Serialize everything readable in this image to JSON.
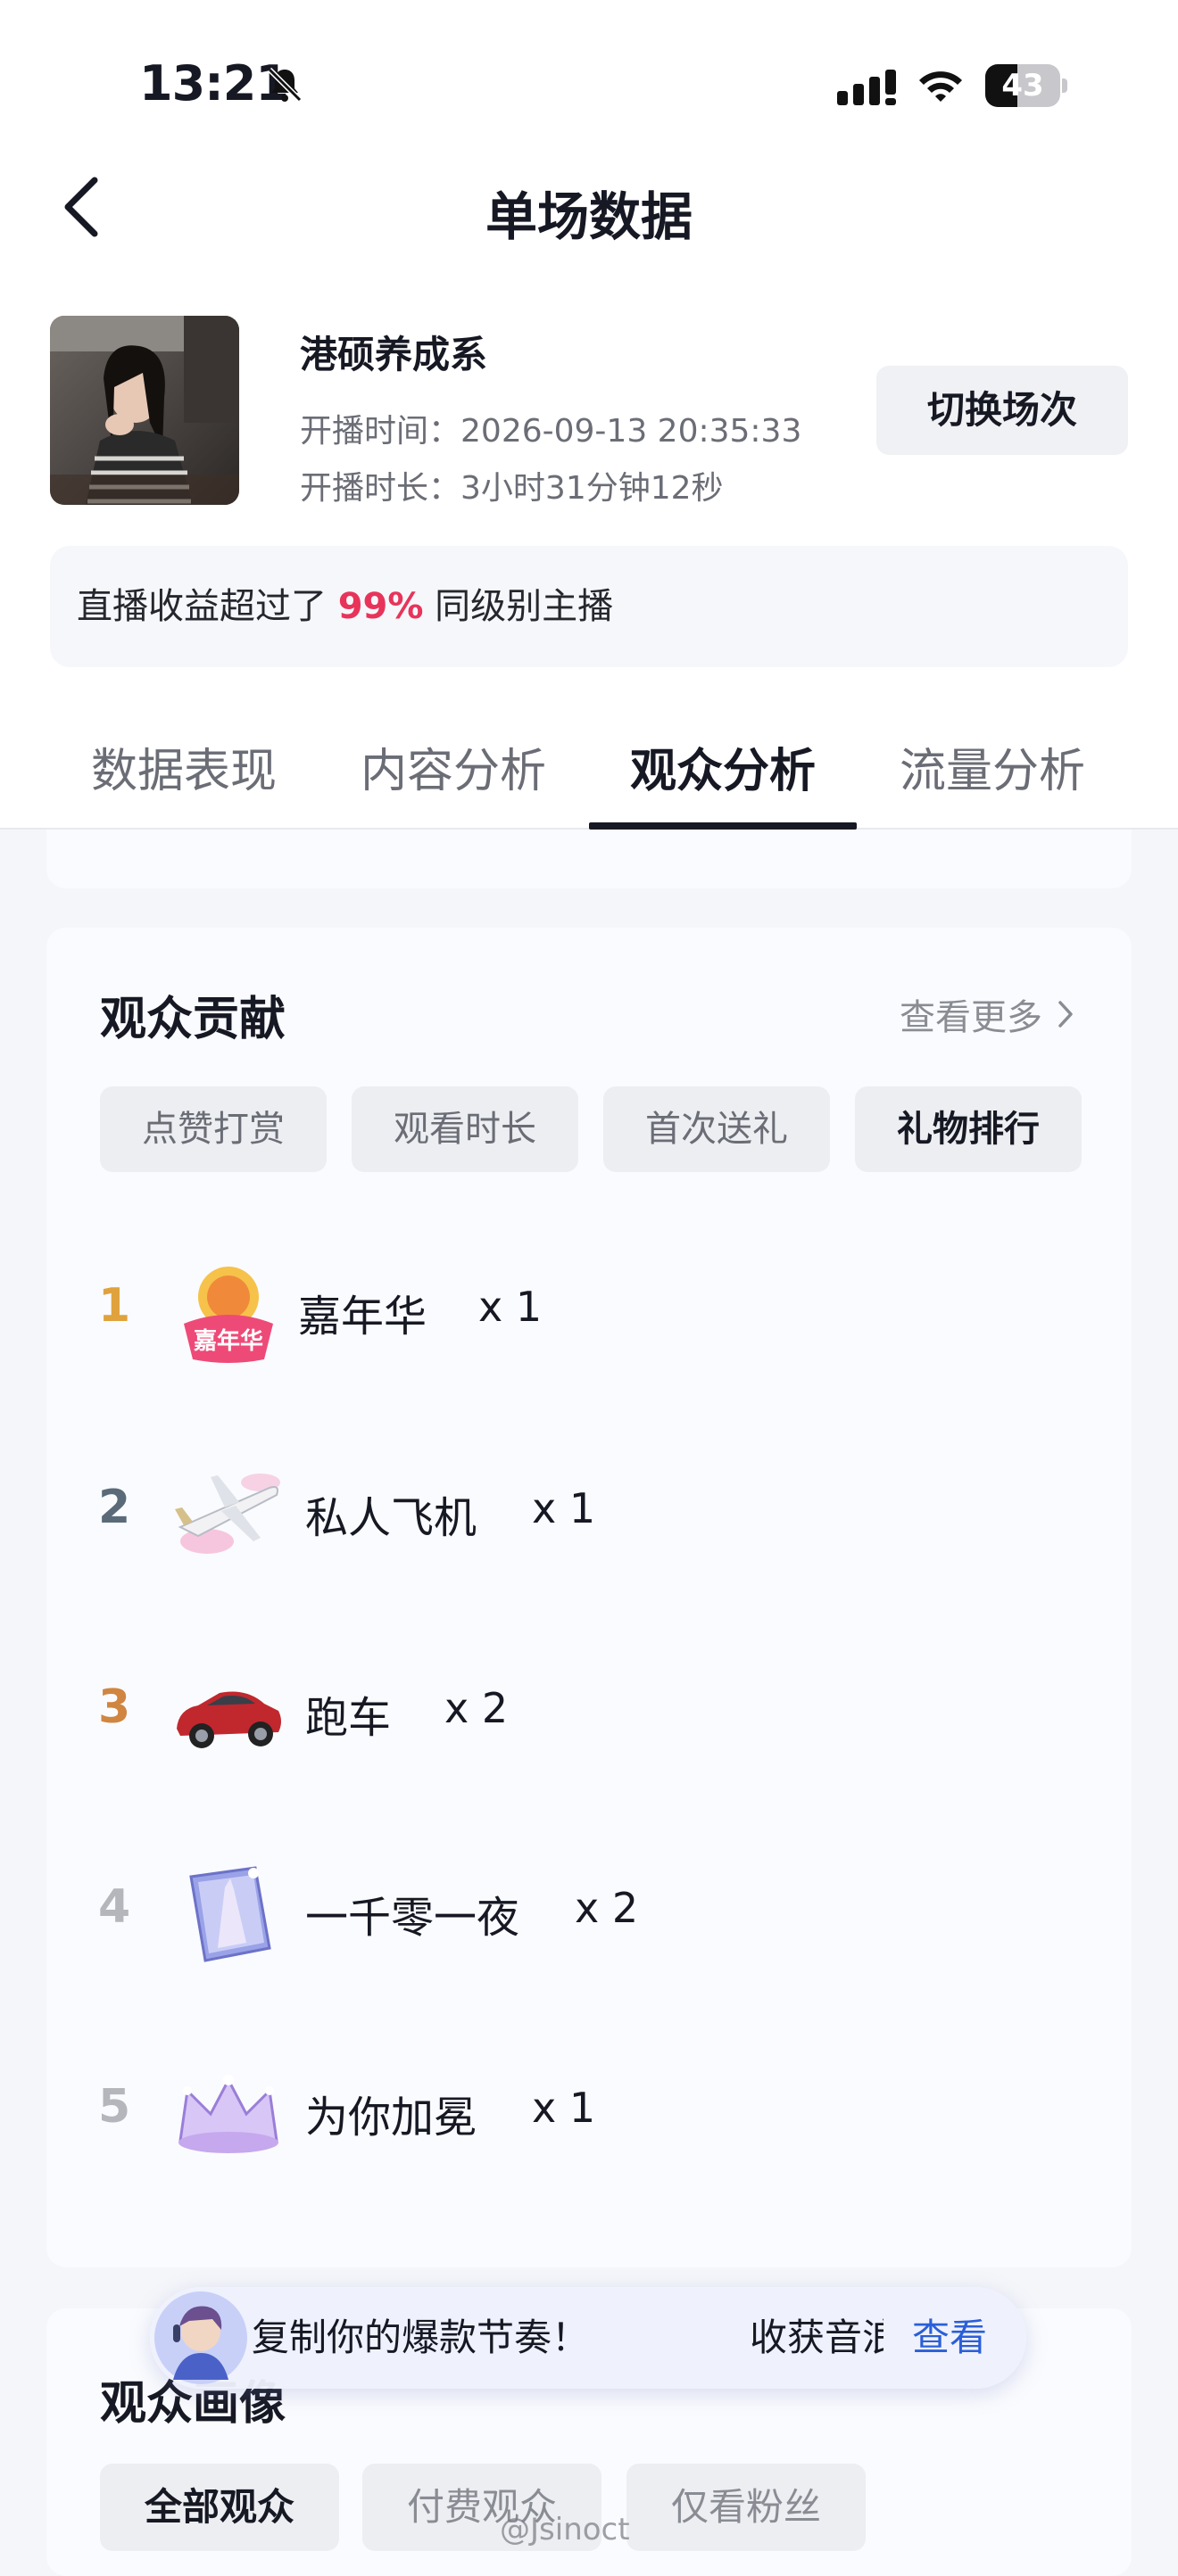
{
  "status_bar": {
    "time": "13:21",
    "battery": "43",
    "battery_level": 0.43
  },
  "header": {
    "title": "单场数据"
  },
  "profile": {
    "name": "港硕养成系",
    "start_time_label": "开播时间：",
    "start_time": "2026-09-13 20:35:33",
    "duration_label": "开播时长：",
    "duration": "3小时31分钟12秒",
    "switch_label": "切换场次"
  },
  "rank_banner": {
    "prefix": "直播收益超过了 ",
    "percent": "99%",
    "suffix": " 同级别主播"
  },
  "tabs": [
    {
      "label": "数据表现"
    },
    {
      "label": "内容分析"
    },
    {
      "label": "观众分析"
    },
    {
      "label": "流量分析"
    }
  ],
  "contribution": {
    "title": "观众贡献",
    "see_more": "查看更多",
    "chips": [
      {
        "label": "点赞打赏"
      },
      {
        "label": "观看时长"
      },
      {
        "label": "首次送礼"
      },
      {
        "label": "礼物排行"
      }
    ],
    "gifts": [
      {
        "rank": "1",
        "name": "嘉年华",
        "count": "x 1",
        "rank_color": "#e0a23c",
        "icon": "carnival-gift-icon"
      },
      {
        "rank": "2",
        "name": "私人飞机",
        "count": "x 1",
        "rank_color": "#5a6a78",
        "icon": "private-jet-gift-icon"
      },
      {
        "rank": "3",
        "name": "跑车",
        "count": "x 2",
        "rank_color": "#d08540",
        "icon": "sports-car-gift-icon"
      },
      {
        "rank": "4",
        "name": "一千零一夜",
        "count": "x 2",
        "rank_color": "#b4b6bc",
        "icon": "arabian-nights-gift-icon"
      },
      {
        "rank": "5",
        "name": "为你加冕",
        "count": "x 1",
        "rank_color": "#b4b6bc",
        "icon": "crown-gift-icon"
      }
    ]
  },
  "promo_banner": {
    "text1": "复制你的爆款节奏！",
    "text2": "收获音浪",
    "link": "查看"
  },
  "portrait": {
    "title": "观众画像",
    "chips": [
      {
        "label": "全部观众"
      },
      {
        "label": "付费观众"
      },
      {
        "label": "仅看粉丝"
      }
    ]
  },
  "watermark": "@Jsinoct",
  "colors": {
    "accent_red": "#e8345a",
    "link_blue": "#2a5fd8"
  }
}
